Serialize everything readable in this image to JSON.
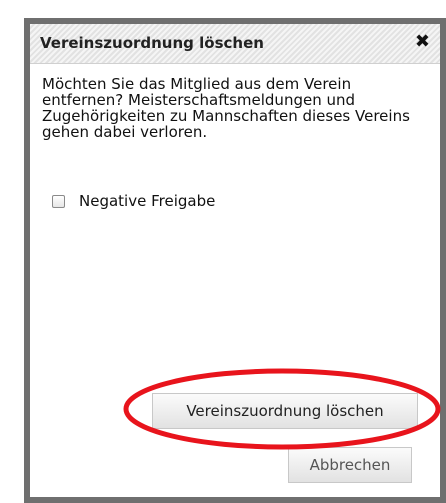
{
  "dialog": {
    "title": "Vereinszuordnung löschen",
    "close_icon": "close-icon",
    "message": "Möchten Sie das Mitglied aus dem Verein entfernen? Meisterschaftsmeldungen und Zugehörigkeiten zu Mannschaften dieses Vereins gehen dabei verloren.",
    "checkbox": {
      "label": "Negative Freigabe",
      "checked": false
    },
    "buttons": {
      "delete_label": "Vereinszuordnung löschen",
      "cancel_label": "Abbrechen"
    }
  },
  "annotation": {
    "highlight_color": "#e8141c"
  },
  "colors": {
    "border": "#6f6f6f",
    "titlebar": "#e9e9e9"
  }
}
